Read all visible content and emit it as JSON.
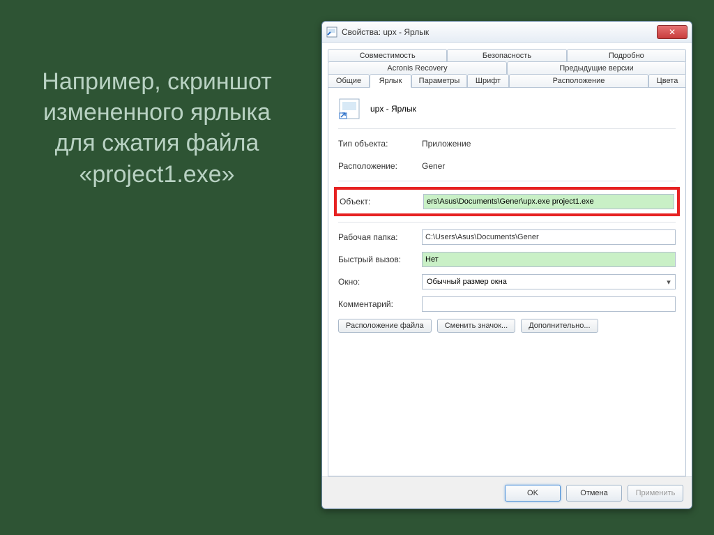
{
  "slide_text": "Например, скриншот измененного ярлыка для сжатия файла «project1.exe»",
  "window": {
    "title": "Свойства: upx - Ярлык",
    "close": "✕"
  },
  "tabs": {
    "row1": [
      "Совместимость",
      "Безопасность",
      "Подробно"
    ],
    "row2": [
      "Acronis Recovery",
      "Предыдущие версии"
    ],
    "row3": [
      "Общие",
      "Ярлык",
      "Параметры",
      "Шрифт",
      "Расположение",
      "Цвета"
    ],
    "active": "Ярлык"
  },
  "panel": {
    "shortcut_name": "upx - Ярлык",
    "fields": {
      "type_label": "Тип объекта:",
      "type_value": "Приложение",
      "location_label": "Расположение:",
      "location_value": "Gener",
      "target_label": "Объект:",
      "target_value": "ers\\Asus\\Documents\\Gener\\upx.exe project1.exe",
      "workdir_label": "Рабочая папка:",
      "workdir_value": "C:\\Users\\Asus\\Documents\\Gener",
      "hotkey_label": "Быстрый вызов:",
      "hotkey_value": "Нет",
      "window_label": "Окно:",
      "window_value": "Обычный размер окна",
      "comment_label": "Комментарий:",
      "comment_value": ""
    },
    "buttons": {
      "open_location": "Расположение файла",
      "change_icon": "Сменить значок...",
      "advanced": "Дополнительно..."
    }
  },
  "footer": {
    "ok": "OK",
    "cancel": "Отмена",
    "apply": "Применить"
  }
}
